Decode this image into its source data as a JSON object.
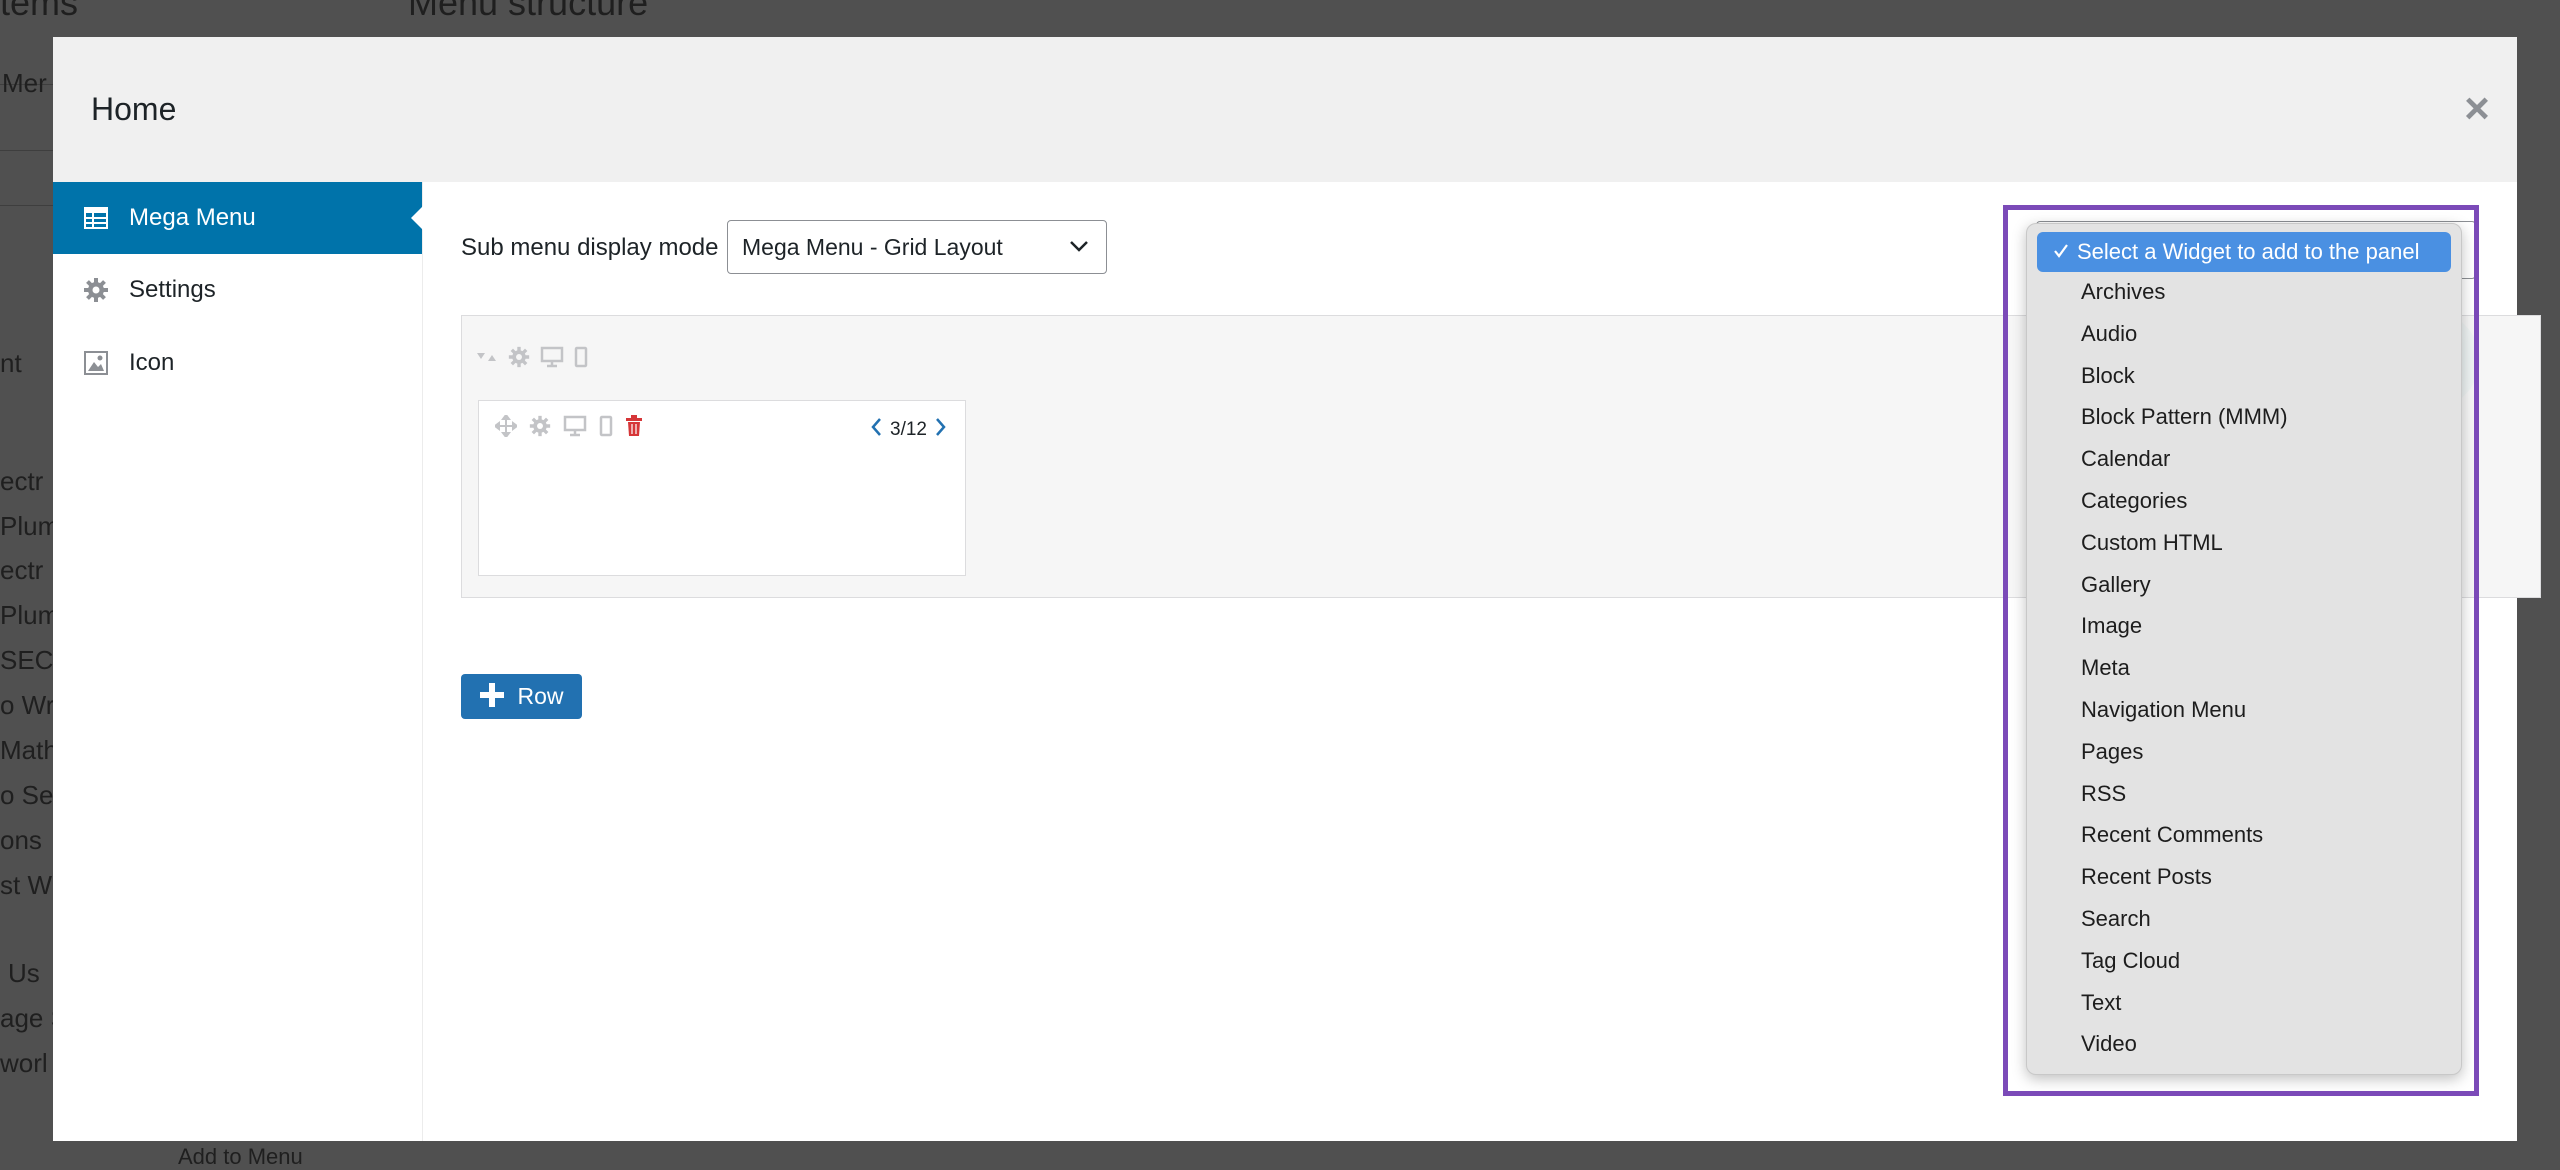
{
  "background": {
    "headings": [
      "Items",
      "Menu structure"
    ],
    "fragments": [
      "Mer",
      "nt",
      "ectr",
      "Plumb",
      "ectr",
      "Plumb",
      "SEC",
      "o Wr",
      "Math",
      "o Se",
      "ons",
      "st W",
      "Us",
      "age S",
      "worl",
      "Add to Menu"
    ]
  },
  "modal": {
    "title": "Home",
    "close_glyph": "×"
  },
  "sidebar": {
    "items": [
      {
        "label": "Mega Menu",
        "icon": "grid-table-icon",
        "active": true
      },
      {
        "label": "Settings",
        "icon": "gear-icon",
        "active": false
      },
      {
        "label": "Icon",
        "icon": "image-icon",
        "active": false
      }
    ]
  },
  "mode": {
    "label": "Sub menu display mode",
    "value": "Mega Menu - Grid Layout"
  },
  "column": {
    "width": "3/12"
  },
  "add_row": {
    "label": "Row"
  },
  "widget_dropdown": {
    "selected": "Select a Widget to add to the panel",
    "options": [
      "Archives",
      "Audio",
      "Block",
      "Block Pattern (MMM)",
      "Calendar",
      "Categories",
      "Custom HTML",
      "Gallery",
      "Image",
      "Meta",
      "Navigation Menu",
      "Pages",
      "RSS",
      "Recent Comments",
      "Recent Posts",
      "Search",
      "Tag Cloud",
      "Text",
      "Video"
    ]
  },
  "colors": {
    "accent": "#0073aa",
    "button": "#2271b1",
    "highlight": "#7b4ab8",
    "selected_option": "#4a90e2",
    "delete": "#d63638"
  }
}
